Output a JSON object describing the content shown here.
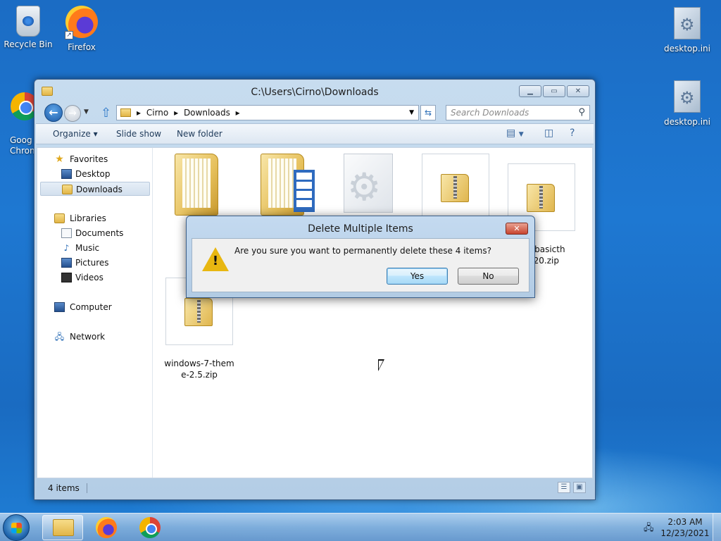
{
  "desktop": {
    "icons": [
      {
        "label": "Recycle Bin"
      },
      {
        "label": "Firefox"
      },
      {
        "label": "Goog\nChron"
      },
      {
        "label": "desktop.ini"
      },
      {
        "label": "desktop.ini"
      }
    ]
  },
  "explorer": {
    "title": "C:\\Users\\Cirno\\Downloads",
    "breadcrumb": [
      "Cirno",
      "Downloads"
    ],
    "search_placeholder": "Search Downloads",
    "toolbar": {
      "organize": "Organize ▾",
      "slideshow": "Slide show",
      "new_folder": "New folder"
    },
    "nav": {
      "favorites": "Favorites",
      "desktop": "Desktop",
      "downloads": "Downloads",
      "libraries": "Libraries",
      "documents": "Documents",
      "music": "Music",
      "pictures": "Pictures",
      "videos": "Videos",
      "computer": "Computer",
      "network": "Network"
    },
    "files": [
      {
        "name": ""
      },
      {
        "name": ""
      },
      {
        "name": ""
      },
      {
        "name": ""
      },
      {
        "name": "ws7basicth\nes20.zip"
      },
      {
        "name": "windows-7-them\ne-2.5.zip"
      }
    ],
    "status": "4 items"
  },
  "dialog": {
    "title": "Delete Multiple Items",
    "message": "Are you sure you want to permanently delete these 4 items?",
    "yes": "Yes",
    "no": "No"
  },
  "taskbar": {
    "time": "2:03 AM",
    "date": "12/23/2021"
  },
  "icons": {
    "back": "back-arrow-icon",
    "forward": "forward-arrow-icon",
    "up": "up-arrow-icon",
    "refresh": "refresh-icon",
    "search": "magnifier-icon",
    "warning": "warning-icon"
  }
}
